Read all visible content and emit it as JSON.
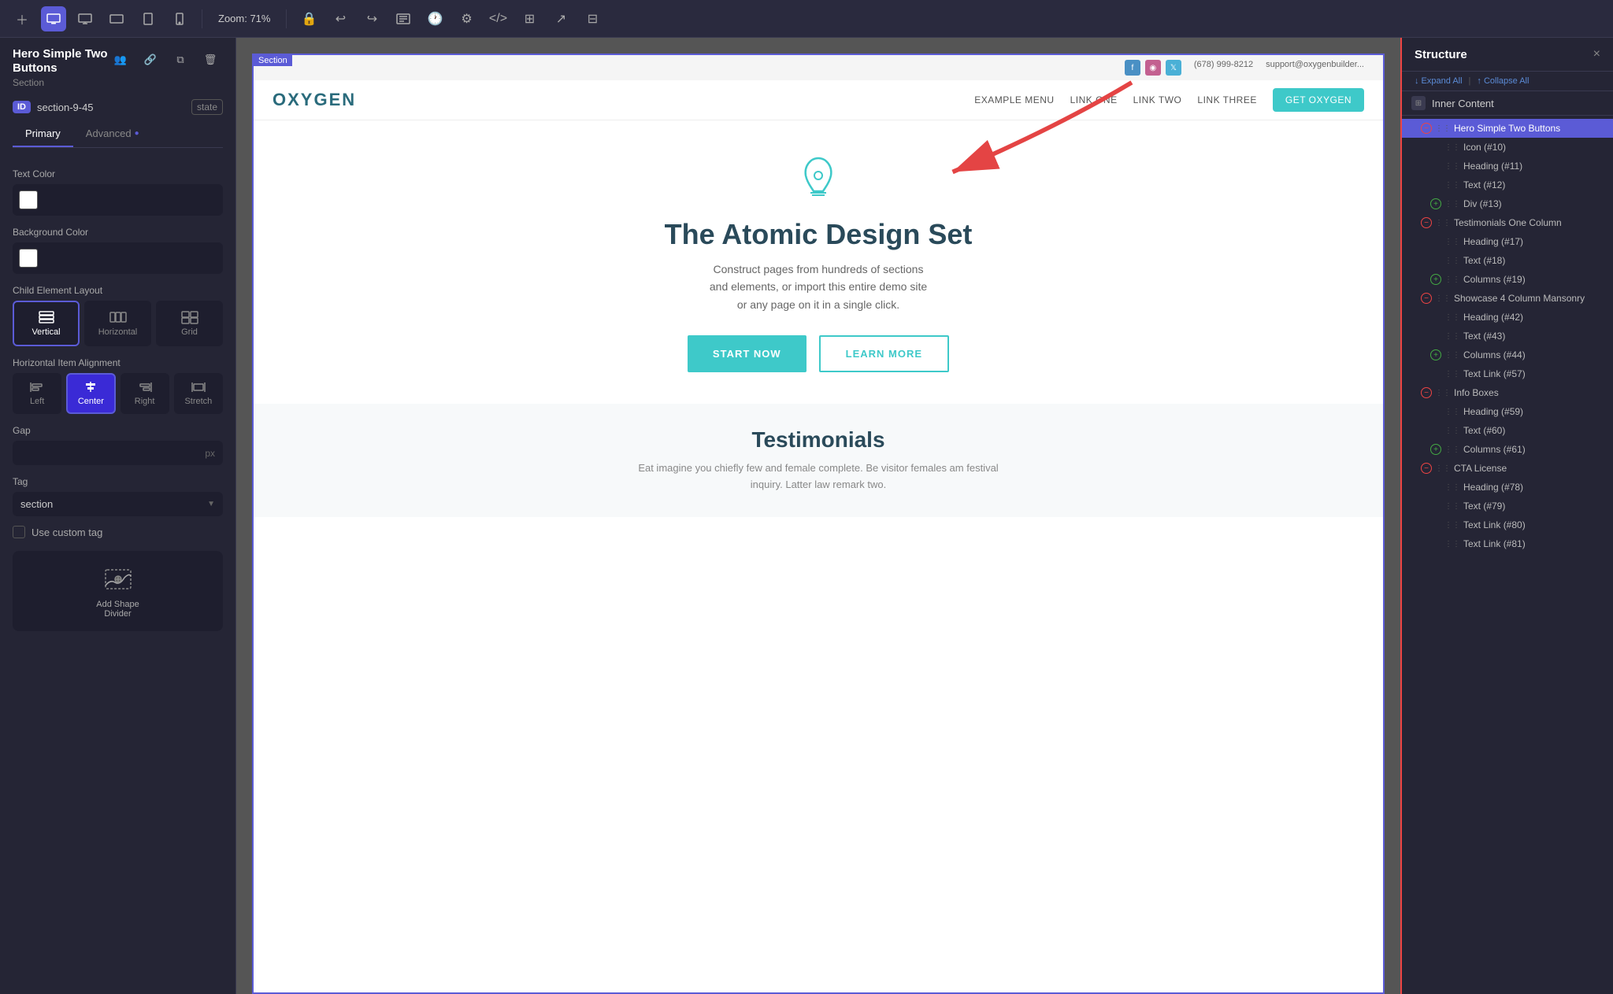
{
  "topbar": {
    "zoom": "Zoom: 71%",
    "undo_icon": "↩",
    "redo_icon": "↪",
    "icons": [
      "desktop",
      "monitor",
      "tablet-landscape",
      "tablet",
      "mobile"
    ]
  },
  "left_panel": {
    "title": "Hero Simple Two Buttons",
    "breadcrumb": "Section",
    "id_value": "section-9-45",
    "id_label": "ID",
    "state_label": "state",
    "tab_primary": "Primary",
    "tab_advanced": "Advanced",
    "text_color_label": "Text Color",
    "bg_color_label": "Background Color",
    "child_layout_label": "Child Element Layout",
    "layout_options": [
      {
        "label": "Vertical",
        "active": true
      },
      {
        "label": "Horizontal",
        "active": false
      },
      {
        "label": "Grid",
        "active": false
      }
    ],
    "alignment_label": "Horizontal Item Alignment",
    "align_options": [
      {
        "label": "Left",
        "active": false
      },
      {
        "label": "Center",
        "active": true
      },
      {
        "label": "Right",
        "active": false
      },
      {
        "label": "Stretch",
        "active": false
      }
    ],
    "gap_label": "Gap",
    "gap_unit": "px",
    "tag_label": "Tag",
    "tag_value": "section",
    "custom_tag_label": "Use custom tag",
    "add_shape_divider_label": "Add Shape\nDivider"
  },
  "preview": {
    "topbar_phone": "(678) 999-8212",
    "topbar_email": "support@oxygenbuilder...",
    "logo": "OXYGEN",
    "nav_items": [
      "EXAMPLE MENU",
      "LINK ONE",
      "LINK TWO",
      "LINK THREE"
    ],
    "nav_cta": "GET OXYGEN",
    "section_badge": "Section",
    "hero_title": "The Atomic Design Set",
    "hero_subtitle": "Construct pages from hundreds of sections\nand elements, or import this entire demo site\nor any page on it in a single click.",
    "hero_btn1": "START NOW",
    "hero_btn2": "LEARN MORE",
    "testimonials_title": "Testimonials",
    "testimonials_sub": "Eat imagine you chiefly few and female complete. Be visitor females am festival\ninquiry. Latter law remark two."
  },
  "right_panel": {
    "title": "Structure",
    "close": "×",
    "expand_label": "↓ Expand All",
    "collapse_label": "↑ Collapse All",
    "inner_content_label": "Inner Content",
    "items": [
      {
        "level": 1,
        "toggle": "minus",
        "label": "Hero Simple Two Buttons",
        "active": true
      },
      {
        "level": 2,
        "toggle": "empty",
        "label": "Icon (#10)",
        "active": false
      },
      {
        "level": 2,
        "toggle": "empty",
        "label": "Heading (#11)",
        "active": false
      },
      {
        "level": 2,
        "toggle": "empty",
        "label": "Text (#12)",
        "active": false
      },
      {
        "level": 2,
        "toggle": "plus",
        "label": "Div (#13)",
        "active": false
      },
      {
        "level": 1,
        "toggle": "minus",
        "label": "Testimonials One Column",
        "active": false
      },
      {
        "level": 2,
        "toggle": "empty",
        "label": "Heading (#17)",
        "active": false
      },
      {
        "level": 2,
        "toggle": "empty",
        "label": "Text (#18)",
        "active": false
      },
      {
        "level": 2,
        "toggle": "plus",
        "label": "Columns (#19)",
        "active": false
      },
      {
        "level": 1,
        "toggle": "minus",
        "label": "Showcase 4 Column Mansonry",
        "active": false
      },
      {
        "level": 2,
        "toggle": "empty",
        "label": "Heading (#42)",
        "active": false
      },
      {
        "level": 2,
        "toggle": "empty",
        "label": "Text (#43)",
        "active": false
      },
      {
        "level": 2,
        "toggle": "plus",
        "label": "Columns (#44)",
        "active": false
      },
      {
        "level": 2,
        "toggle": "empty",
        "label": "Text Link (#57)",
        "active": false
      },
      {
        "level": 1,
        "toggle": "minus",
        "label": "Info Boxes",
        "active": false
      },
      {
        "level": 2,
        "toggle": "empty",
        "label": "Heading (#59)",
        "active": false
      },
      {
        "level": 2,
        "toggle": "empty",
        "label": "Text (#60)",
        "active": false
      },
      {
        "level": 2,
        "toggle": "plus",
        "label": "Columns (#61)",
        "active": false
      },
      {
        "level": 1,
        "toggle": "minus",
        "label": "CTA License",
        "active": false
      },
      {
        "level": 2,
        "toggle": "empty",
        "label": "Heading (#78)",
        "active": false
      },
      {
        "level": 2,
        "toggle": "empty",
        "label": "Text (#79)",
        "active": false
      },
      {
        "level": 2,
        "toggle": "empty",
        "label": "Text Link (#80)",
        "active": false
      },
      {
        "level": 2,
        "toggle": "empty",
        "label": "Text Link (#81)",
        "active": false
      }
    ]
  },
  "colors": {
    "accent": "#5b5bd6",
    "teal": "#3ec9c9",
    "red_border": "#e44444"
  }
}
